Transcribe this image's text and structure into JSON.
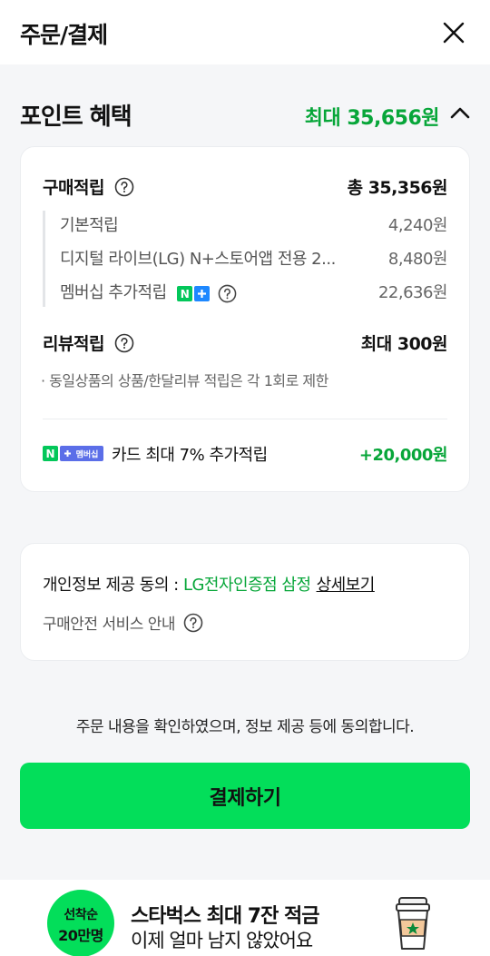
{
  "header": {
    "title": "주문/결제"
  },
  "points": {
    "title": "포인트 혜택",
    "max_label": "최대 35,656원",
    "purchase": {
      "label": "구매적립",
      "total": "총 35,356원",
      "items": [
        {
          "label": "기본적립",
          "value": "4,240원"
        },
        {
          "label": "디지털 라이브(LG) N+스토어앱 전용 2...",
          "value": "8,480원"
        },
        {
          "label": "멤버십 추가적립",
          "value": "22,636원"
        }
      ]
    },
    "review": {
      "label": "리뷰적립",
      "value": "최대 300원",
      "note": "· 동일상품의 상품/한달리뷰 적립은 각 1회로 제한"
    },
    "card": {
      "text": "카드 최대 7% 추가적립",
      "value": "+20,000원",
      "badge_text": "멤버십"
    }
  },
  "privacy": {
    "label": "개인정보 제공 동의 : ",
    "seller": "LG전자인증점 삼정",
    "link": "상세보기",
    "safe_service": "구매안전 서비스 안내"
  },
  "agreement_text": "주문 내용을 확인하였으며, 정보 제공 등에 동의합니다.",
  "pay_button": "결제하기",
  "banner": {
    "badge_line1": "선착순",
    "badge_line2": "20만명",
    "title": "스타벅스 최대 7잔 적금",
    "subtitle": "이제 얼마 남지 않았어요"
  },
  "colors": {
    "accent_green": "#07a639",
    "button_green": "#03de5a",
    "background": "#f5f6f8"
  }
}
